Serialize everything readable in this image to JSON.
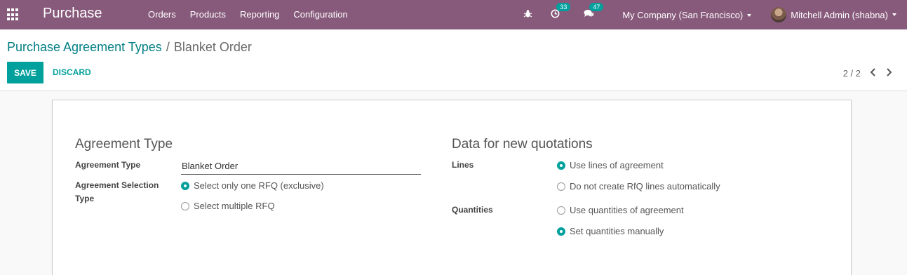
{
  "navbar": {
    "app_title": "Purchase",
    "menu": [
      "Orders",
      "Products",
      "Reporting",
      "Configuration"
    ],
    "activity_count": "33",
    "message_count": "47",
    "company": "My Company (San Francisco)",
    "user": "Mitchell Admin (shabna)"
  },
  "breadcrumb": {
    "parent": "Purchase Agreement Types",
    "separator": "/",
    "current": "Blanket Order"
  },
  "buttons": {
    "save": "SAVE",
    "discard": "DISCARD"
  },
  "pager": {
    "value": "2 / 2"
  },
  "form": {
    "agreement_group_title": "Agreement Type",
    "agreement_type_label": "Agreement Type",
    "agreement_type_value": "Blanket Order",
    "selection_type_label": "Agreement Selection Type",
    "selection_options": [
      {
        "label": "Select only one RFQ (exclusive)",
        "checked": true
      },
      {
        "label": "Select multiple RFQ",
        "checked": false
      }
    ],
    "quotations_group_title": "Data for new quotations",
    "lines_label": "Lines",
    "lines_options": [
      {
        "label": "Use lines of agreement",
        "checked": true
      },
      {
        "label": "Do not create RfQ lines automatically",
        "checked": false
      }
    ],
    "quantities_label": "Quantities",
    "quantities_options": [
      {
        "label": "Use quantities of agreement",
        "checked": false
      },
      {
        "label": "Set quantities manually",
        "checked": true
      }
    ]
  },
  "colors": {
    "navbar": "#875a7b",
    "accent": "#00a09d",
    "link": "#017e84"
  }
}
